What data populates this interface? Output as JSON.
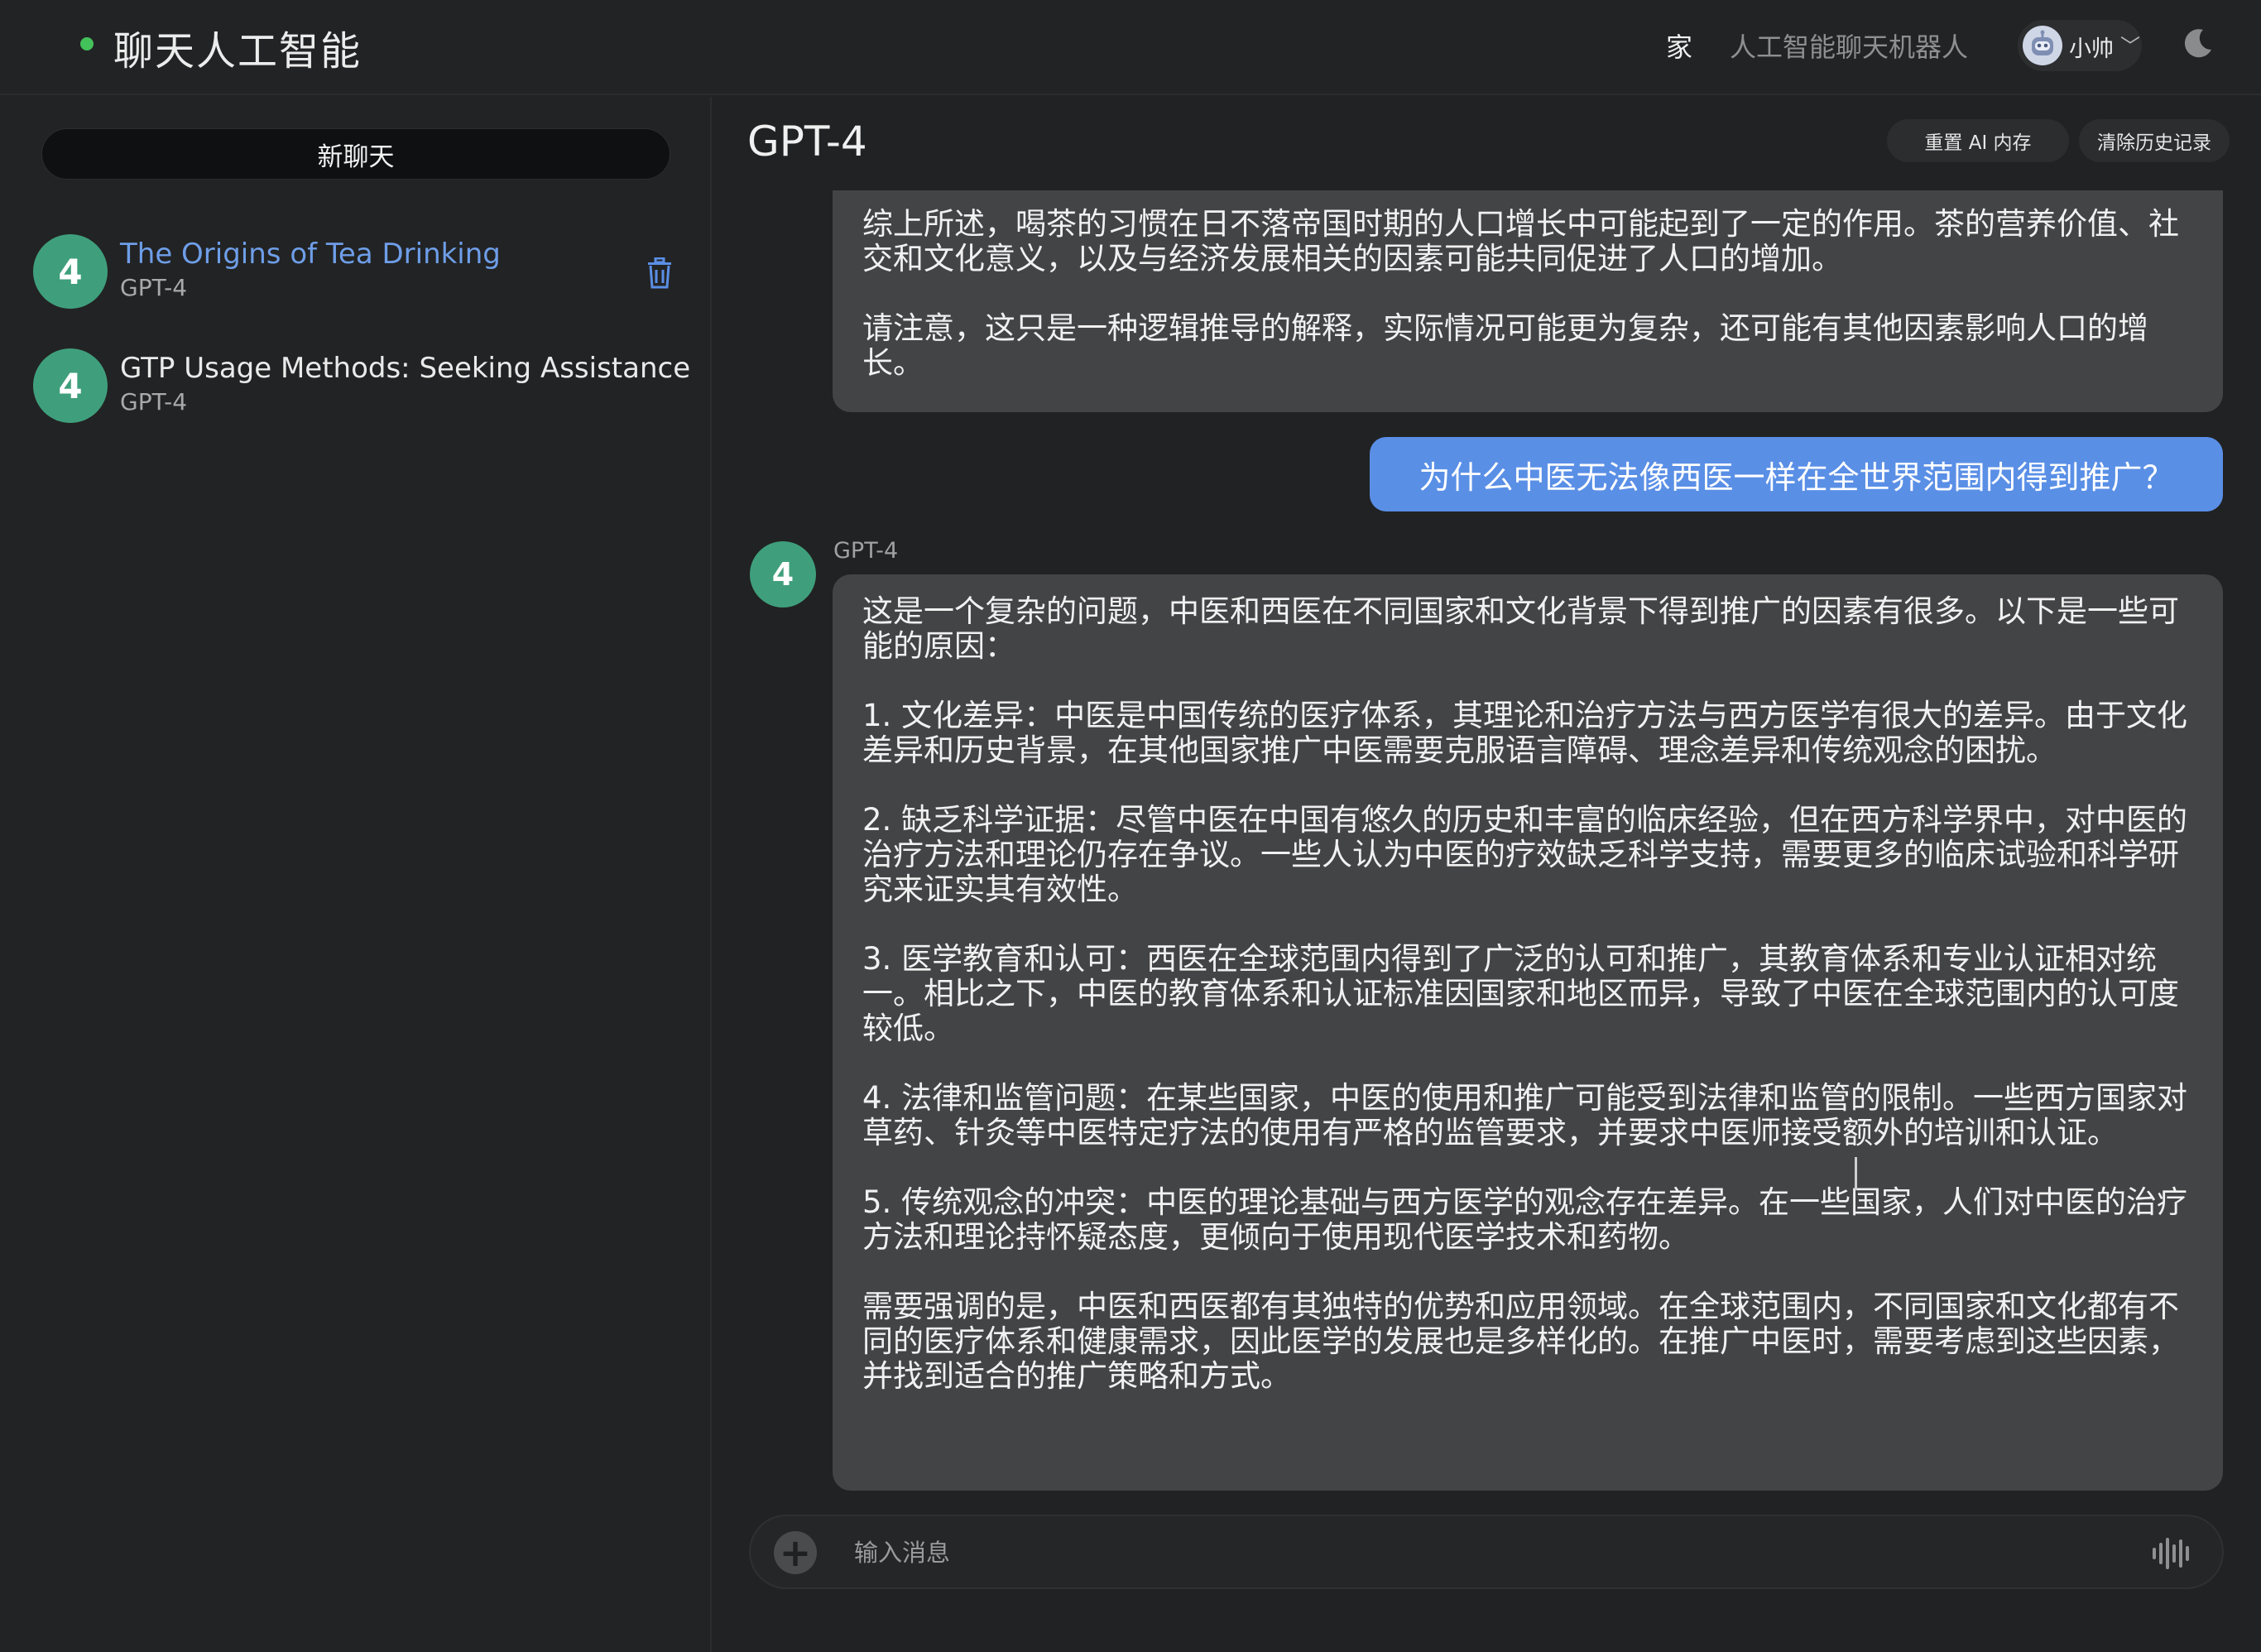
{
  "app": {
    "title": "聊天人工智能",
    "status_color": "#43c15a"
  },
  "nav": {
    "home": "家",
    "bot": "人工智能聊天机器人",
    "user_name": "小帅",
    "user_chevron": "﹀",
    "theme_icon": "moon-icon"
  },
  "sidebar": {
    "new_chat": "新聊天",
    "conversations": [
      {
        "badge": "4",
        "title": "The Origins of Tea Drinking",
        "model": "GPT-4",
        "active": true
      },
      {
        "badge": "4",
        "title": "GTP Usage Methods: Seeking Assistance",
        "model": "GPT-4",
        "active": false
      }
    ]
  },
  "main": {
    "title": "GPT-4",
    "reset_memory": "重置 AI 内存",
    "clear_history": "清除历史记录"
  },
  "messages": {
    "prev_bot_text": "综上所述，喝茶的习惯在日不落帝国时期的人口增长中可能起到了一定的作用。茶的营养价值、社交和文化意义，以及与经济发展相关的因素可能共同促进了人口的增加。\n\n请注意，这只是一种逻辑推导的解释，实际情况可能更为复杂，还可能有其他因素影响人口的增长。",
    "user_text": "为什么中医无法像西医一样在全世界范围内得到推广？",
    "bot_badge": "4",
    "bot_label": "GPT-4",
    "bot_text": "这是一个复杂的问题，中医和西医在不同国家和文化背景下得到推广的因素有很多。以下是一些可能的原因：\n\n1. 文化差异：中医是中国传统的医疗体系，其理论和治疗方法与西方医学有很大的差异。由于文化差异和历史背景，在其他国家推广中医需要克服语言障碍、理念差异和传统观念的困扰。\n\n2. 缺乏科学证据：尽管中医在中国有悠久的历史和丰富的临床经验，但在西方科学界中，对中医的治疗方法和理论仍存在争议。一些人认为中医的疗效缺乏科学支持，需要更多的临床试验和科学研究来证实其有效性。\n\n3. 医学教育和认可：西医在全球范围内得到了广泛的认可和推广，其教育体系和专业认证相对统一。相比之下，中医的教育体系和认证标准因国家和地区而异，导致了中医在全球范围内的认可度较低。\n\n4. 法律和监管问题：在某些国家，中医的使用和推广可能受到法律和监管的限制。一些西方国家对草药、针灸等中医特定疗法的使用有严格的监管要求，并要求中医师接受额外的培训和认证。\n\n5. 传统观念的冲突：中医的理论基础与西方医学的观念存在差异。在一些国家，人们对中医的治疗方法和理论持怀疑态度，更倾向于使用现代医学技术和药物。\n\n需要强调的是，中医和西医都有其独特的优势和应用领域。在全球范围内，不同国家和文化都有不同的医疗体系和健康需求，因此医学的发展也是多样化的。在推广中医时，需要考虑到这些因素，并找到适合的推广策略和方式。"
  },
  "input": {
    "placeholder": "输入消息",
    "value": "",
    "plus_icon": "+"
  },
  "colors": {
    "accent_blue": "#5a8fe6",
    "badge_green": "#3f9f7c",
    "active_link": "#6e9ee8"
  }
}
